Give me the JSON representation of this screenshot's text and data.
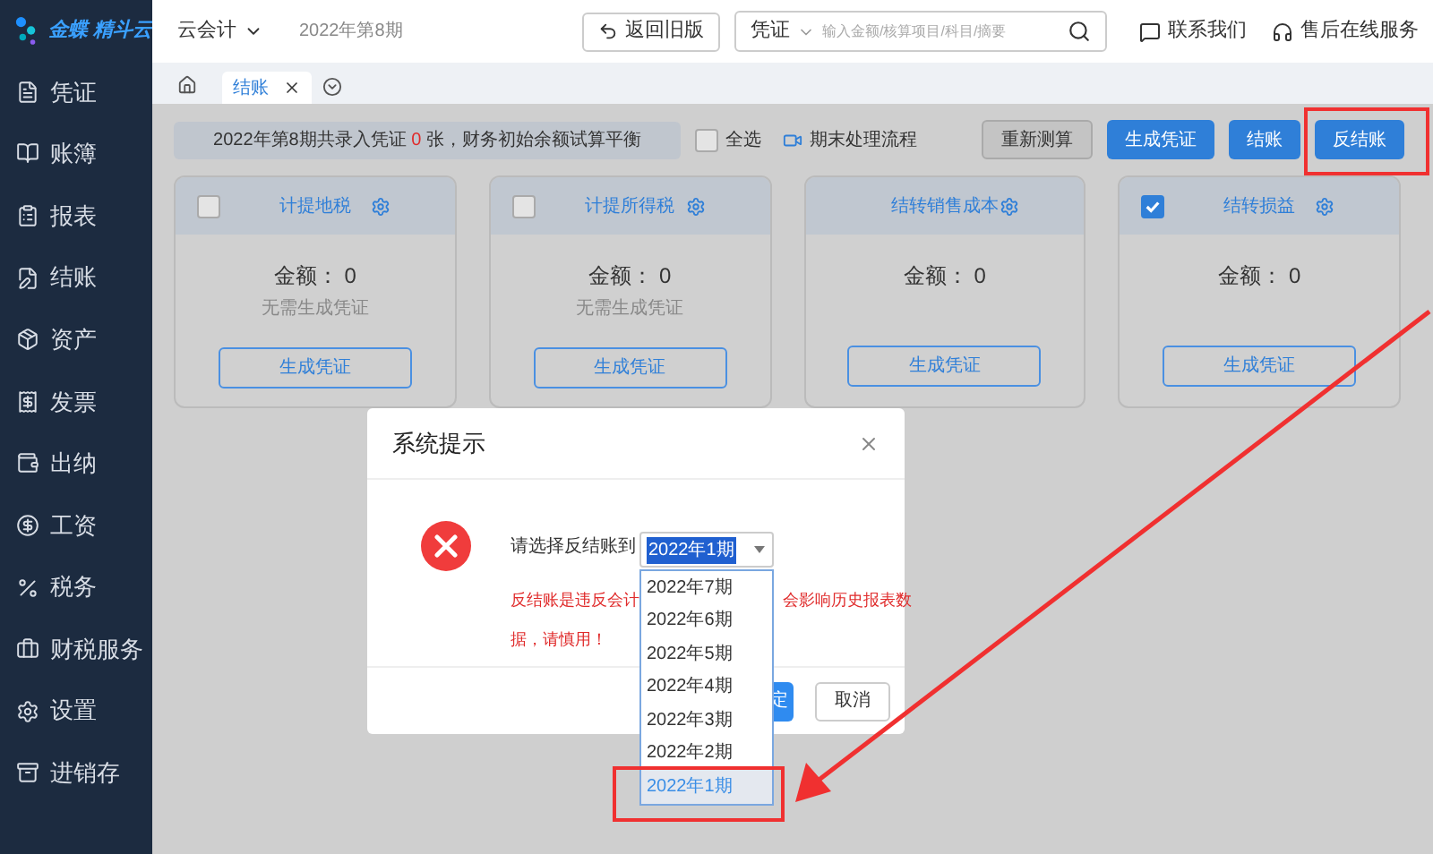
{
  "logo": {
    "text": "金蝶 精斗云"
  },
  "sidebar": {
    "items": [
      {
        "label": "凭证",
        "selected": false
      },
      {
        "label": "账簿",
        "selected": false
      },
      {
        "label": "报表",
        "selected": false
      },
      {
        "label": "结账",
        "selected": false
      },
      {
        "label": "资产",
        "selected": false
      },
      {
        "label": "发票",
        "selected": false
      },
      {
        "label": "出纳",
        "selected": false
      },
      {
        "label": "工资",
        "selected": false
      },
      {
        "label": "税务",
        "selected": false
      },
      {
        "label": "财税服务",
        "selected": false
      },
      {
        "label": "设置",
        "selected": false
      },
      {
        "label": "进销存",
        "selected": false
      }
    ]
  },
  "header": {
    "app": "云会计",
    "period": "2022年第8期",
    "back_button": "返回旧版",
    "search": {
      "category": "凭证",
      "placeholder": "输入金额/核算项目/科目/摘要"
    },
    "links": [
      "联系我们",
      "售后在线服务"
    ]
  },
  "tabs": [
    {
      "label": "结账",
      "selected": true
    }
  ],
  "notice": {
    "prefix": "2022年第8期共录入凭证",
    "count": "0",
    "suffix": "张，财务初始余额试算平衡"
  },
  "select_all": {
    "label": "全选",
    "checked": false
  },
  "flow_link": "期末处理流程",
  "buttons": [
    {
      "label": "重新测算",
      "kind": "plain"
    },
    {
      "label": "生成凭证",
      "kind": "primary"
    },
    {
      "label": "结账",
      "kind": "primary"
    },
    {
      "label": "反结账",
      "kind": "primary"
    }
  ],
  "cards": [
    {
      "title": "计提地税",
      "checked": false,
      "amount": "金额： 0",
      "note": "无需生成凭证",
      "button": "生成凭证"
    },
    {
      "title": "计提所得税",
      "checked": false,
      "amount": "金额： 0",
      "note": "无需生成凭证",
      "button": "生成凭证"
    },
    {
      "title": "结转销售成本",
      "amount": "金额： 0",
      "button": "生成凭证"
    },
    {
      "title": "结转损益",
      "checked": true,
      "amount": "金额： 0",
      "button": "生成凭证"
    }
  ],
  "dialog": {
    "title": "系统提示",
    "label": "请选择反结账到",
    "select_value": "2022年1期",
    "options": [
      {
        "label": "2022年7期",
        "selected": false
      },
      {
        "label": "2022年6期",
        "selected": false
      },
      {
        "label": "2022年5期",
        "selected": false
      },
      {
        "label": "2022年4期",
        "selected": false
      },
      {
        "label": "2022年3期",
        "selected": false
      },
      {
        "label": "2022年2期",
        "selected": false
      },
      {
        "label": "2022年1期",
        "selected": true
      }
    ],
    "warning_start": "反结账是违反会计",
    "warning_end": "会影响历史报表数",
    "warning_line2": "据，请慎用！",
    "confirm": "定",
    "cancel": "取消"
  }
}
